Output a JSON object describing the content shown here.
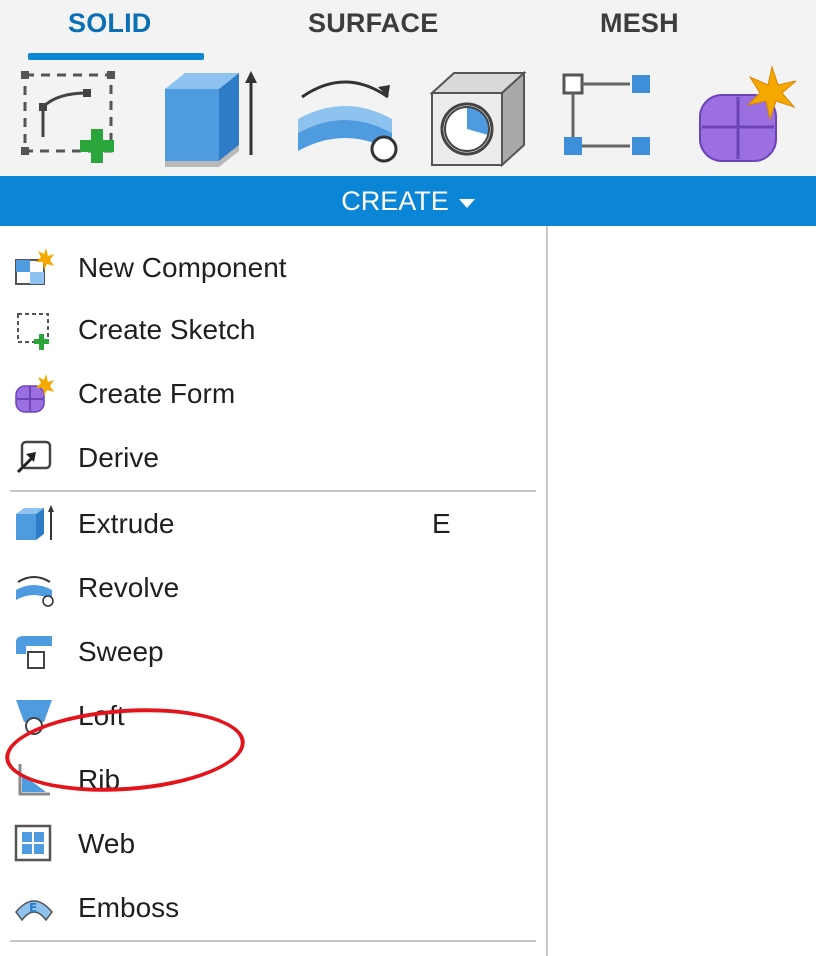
{
  "tabs": [
    {
      "label": "SOLID",
      "active": true
    },
    {
      "label": "SURFACE",
      "active": false
    },
    {
      "label": "MESH",
      "active": false
    }
  ],
  "ribbon": {
    "tools": [
      {
        "icon": "create-sketch-icon"
      },
      {
        "icon": "extrude-icon"
      },
      {
        "icon": "revolve-icon"
      },
      {
        "icon": "hole-icon"
      },
      {
        "icon": "pattern-icon"
      },
      {
        "icon": "create-form-icon"
      }
    ],
    "group_label": "CREATE"
  },
  "menu": {
    "items": [
      {
        "label": "New Component",
        "icon": "new-component-icon",
        "shortcut": ""
      },
      {
        "label": "Create Sketch",
        "icon": "create-sketch-icon",
        "shortcut": ""
      },
      {
        "label": "Create Form",
        "icon": "create-form-icon",
        "shortcut": ""
      },
      {
        "label": "Derive",
        "icon": "derive-icon",
        "shortcut": ""
      },
      {
        "label": "Extrude",
        "icon": "extrude-icon",
        "shortcut": "E",
        "annotated": true
      },
      {
        "label": "Revolve",
        "icon": "revolve-icon",
        "shortcut": ""
      },
      {
        "label": "Sweep",
        "icon": "sweep-icon",
        "shortcut": ""
      },
      {
        "label": "Loft",
        "icon": "loft-icon",
        "shortcut": ""
      },
      {
        "label": "Rib",
        "icon": "rib-icon",
        "shortcut": ""
      },
      {
        "label": "Web",
        "icon": "web-icon",
        "shortcut": ""
      },
      {
        "label": "Emboss",
        "icon": "emboss-icon",
        "shortcut": ""
      }
    ]
  },
  "colors": {
    "accent": "#0b86d6",
    "active_tab": "#0b6fb5",
    "annotation": "#e3141b"
  }
}
